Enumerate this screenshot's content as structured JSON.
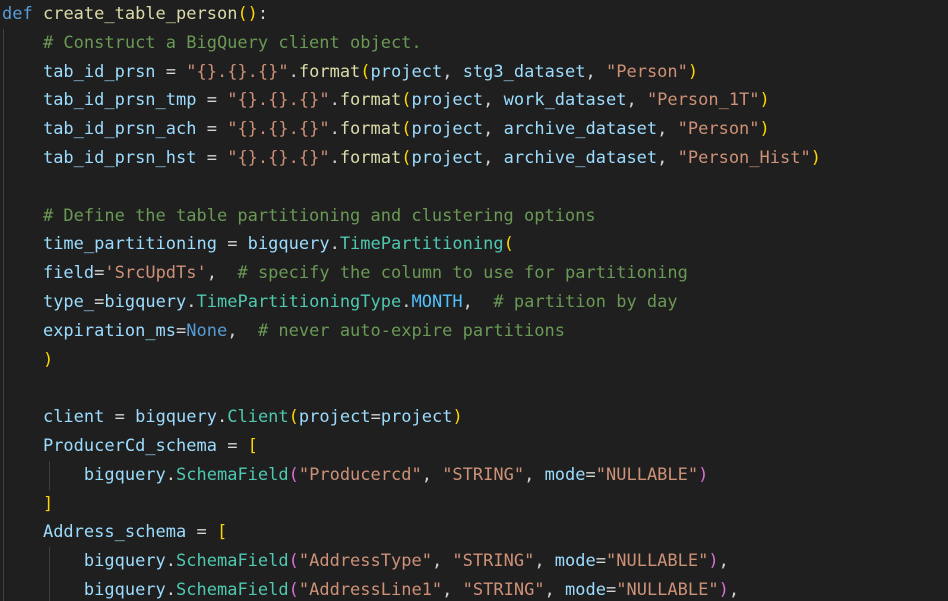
{
  "colors": {
    "background": "#1f1f1f",
    "keyword": "#569cd6",
    "function": "#dcdcaa",
    "variable": "#9cdcfe",
    "string": "#ce9178",
    "comment": "#6a9955",
    "class": "#4ec9b0",
    "constant": "#4fc1ff",
    "bracket_level1": "#ffd700",
    "bracket_level2": "#da70d6",
    "bracket_level3": "#179fff"
  },
  "code": {
    "lines": [
      {
        "indent": 0,
        "tokens": [
          {
            "t": "def",
            "c": "kw"
          },
          {
            "t": " ",
            "c": "op"
          },
          {
            "t": "create_table_person",
            "c": "fn"
          },
          {
            "t": "()",
            "c": "br1"
          },
          {
            "t": ":",
            "c": "op"
          }
        ]
      },
      {
        "indent": 1,
        "tokens": [
          {
            "t": "# Construct a BigQuery client object.",
            "c": "cmt"
          }
        ]
      },
      {
        "indent": 1,
        "tokens": [
          {
            "t": "tab_id_prsn",
            "c": "var"
          },
          {
            "t": " = ",
            "c": "op"
          },
          {
            "t": "\"{}.{}.{}\"",
            "c": "str"
          },
          {
            "t": ".",
            "c": "op"
          },
          {
            "t": "format",
            "c": "fn"
          },
          {
            "t": "(",
            "c": "br1"
          },
          {
            "t": "project",
            "c": "var"
          },
          {
            "t": ", ",
            "c": "op"
          },
          {
            "t": "stg3_dataset",
            "c": "var"
          },
          {
            "t": ", ",
            "c": "op"
          },
          {
            "t": "\"Person\"",
            "c": "str"
          },
          {
            "t": ")",
            "c": "br1"
          }
        ]
      },
      {
        "indent": 1,
        "tokens": [
          {
            "t": "tab_id_prsn_tmp",
            "c": "var"
          },
          {
            "t": " = ",
            "c": "op"
          },
          {
            "t": "\"{}.{}.{}\"",
            "c": "str"
          },
          {
            "t": ".",
            "c": "op"
          },
          {
            "t": "format",
            "c": "fn"
          },
          {
            "t": "(",
            "c": "br1"
          },
          {
            "t": "project",
            "c": "var"
          },
          {
            "t": ", ",
            "c": "op"
          },
          {
            "t": "work_dataset",
            "c": "var"
          },
          {
            "t": ", ",
            "c": "op"
          },
          {
            "t": "\"Person_1T\"",
            "c": "str"
          },
          {
            "t": ")",
            "c": "br1"
          }
        ]
      },
      {
        "indent": 1,
        "tokens": [
          {
            "t": "tab_id_prsn_ach",
            "c": "var"
          },
          {
            "t": " = ",
            "c": "op"
          },
          {
            "t": "\"{}.{}.{}\"",
            "c": "str"
          },
          {
            "t": ".",
            "c": "op"
          },
          {
            "t": "format",
            "c": "fn"
          },
          {
            "t": "(",
            "c": "br1"
          },
          {
            "t": "project",
            "c": "var"
          },
          {
            "t": ", ",
            "c": "op"
          },
          {
            "t": "archive_dataset",
            "c": "var"
          },
          {
            "t": ", ",
            "c": "op"
          },
          {
            "t": "\"Person\"",
            "c": "str"
          },
          {
            "t": ")",
            "c": "br1"
          }
        ]
      },
      {
        "indent": 1,
        "tokens": [
          {
            "t": "tab_id_prsn_hst",
            "c": "var"
          },
          {
            "t": " = ",
            "c": "op"
          },
          {
            "t": "\"{}.{}.{}\"",
            "c": "str"
          },
          {
            "t": ".",
            "c": "op"
          },
          {
            "t": "format",
            "c": "fn"
          },
          {
            "t": "(",
            "c": "br1"
          },
          {
            "t": "project",
            "c": "var"
          },
          {
            "t": ", ",
            "c": "op"
          },
          {
            "t": "archive_dataset",
            "c": "var"
          },
          {
            "t": ", ",
            "c": "op"
          },
          {
            "t": "\"Person_Hist\"",
            "c": "str"
          },
          {
            "t": ")",
            "c": "br1"
          }
        ]
      },
      {
        "indent": 1,
        "tokens": []
      },
      {
        "indent": 1,
        "tokens": [
          {
            "t": "# Define the table partitioning and clustering options",
            "c": "cmt"
          }
        ]
      },
      {
        "indent": 1,
        "tokens": [
          {
            "t": "time_partitioning",
            "c": "var"
          },
          {
            "t": " = ",
            "c": "op"
          },
          {
            "t": "bigquery",
            "c": "var"
          },
          {
            "t": ".",
            "c": "op"
          },
          {
            "t": "TimePartitioning",
            "c": "cls"
          },
          {
            "t": "(",
            "c": "br1"
          }
        ]
      },
      {
        "indent": 1,
        "tokens": [
          {
            "t": "field",
            "c": "var"
          },
          {
            "t": "=",
            "c": "op"
          },
          {
            "t": "'SrcUpdTs'",
            "c": "str"
          },
          {
            "t": ",  ",
            "c": "op"
          },
          {
            "t": "# specify the column to use for partitioning",
            "c": "cmt"
          }
        ]
      },
      {
        "indent": 1,
        "tokens": [
          {
            "t": "type_",
            "c": "var"
          },
          {
            "t": "=",
            "c": "op"
          },
          {
            "t": "bigquery",
            "c": "var"
          },
          {
            "t": ".",
            "c": "op"
          },
          {
            "t": "TimePartitioningType",
            "c": "cls"
          },
          {
            "t": ".",
            "c": "op"
          },
          {
            "t": "MONTH",
            "c": "const"
          },
          {
            "t": ",  ",
            "c": "op"
          },
          {
            "t": "# partition by day",
            "c": "cmt"
          }
        ]
      },
      {
        "indent": 1,
        "tokens": [
          {
            "t": "expiration_ms",
            "c": "var"
          },
          {
            "t": "=",
            "c": "op"
          },
          {
            "t": "None",
            "c": "kw"
          },
          {
            "t": ",  ",
            "c": "op"
          },
          {
            "t": "# never auto-expire partitions",
            "c": "cmt"
          }
        ]
      },
      {
        "indent": 1,
        "tokens": [
          {
            "t": ")",
            "c": "br1"
          }
        ]
      },
      {
        "indent": 1,
        "tokens": []
      },
      {
        "indent": 1,
        "tokens": [
          {
            "t": "client",
            "c": "var"
          },
          {
            "t": " = ",
            "c": "op"
          },
          {
            "t": "bigquery",
            "c": "var"
          },
          {
            "t": ".",
            "c": "op"
          },
          {
            "t": "Client",
            "c": "cls"
          },
          {
            "t": "(",
            "c": "br1"
          },
          {
            "t": "project",
            "c": "var"
          },
          {
            "t": "=",
            "c": "op"
          },
          {
            "t": "project",
            "c": "var"
          },
          {
            "t": ")",
            "c": "br1"
          }
        ]
      },
      {
        "indent": 1,
        "tokens": [
          {
            "t": "ProducerCd_schema",
            "c": "var"
          },
          {
            "t": " = ",
            "c": "op"
          },
          {
            "t": "[",
            "c": "br1"
          }
        ]
      },
      {
        "indent": 2,
        "tokens": [
          {
            "t": "bigquery",
            "c": "var"
          },
          {
            "t": ".",
            "c": "op"
          },
          {
            "t": "SchemaField",
            "c": "cls"
          },
          {
            "t": "(",
            "c": "br2"
          },
          {
            "t": "\"Producercd\"",
            "c": "str"
          },
          {
            "t": ", ",
            "c": "op"
          },
          {
            "t": "\"STRING\"",
            "c": "str"
          },
          {
            "t": ", ",
            "c": "op"
          },
          {
            "t": "mode",
            "c": "var"
          },
          {
            "t": "=",
            "c": "op"
          },
          {
            "t": "\"NULLABLE\"",
            "c": "str"
          },
          {
            "t": ")",
            "c": "br2"
          }
        ]
      },
      {
        "indent": 1,
        "tokens": [
          {
            "t": "]",
            "c": "br1"
          }
        ]
      },
      {
        "indent": 1,
        "tokens": [
          {
            "t": "Address_schema",
            "c": "var"
          },
          {
            "t": " = ",
            "c": "op"
          },
          {
            "t": "[",
            "c": "br1"
          }
        ]
      },
      {
        "indent": 2,
        "tokens": [
          {
            "t": "bigquery",
            "c": "var"
          },
          {
            "t": ".",
            "c": "op"
          },
          {
            "t": "SchemaField",
            "c": "cls"
          },
          {
            "t": "(",
            "c": "br2"
          },
          {
            "t": "\"AddressType\"",
            "c": "str"
          },
          {
            "t": ", ",
            "c": "op"
          },
          {
            "t": "\"STRING\"",
            "c": "str"
          },
          {
            "t": ", ",
            "c": "op"
          },
          {
            "t": "mode",
            "c": "var"
          },
          {
            "t": "=",
            "c": "op"
          },
          {
            "t": "\"NULLABLE\"",
            "c": "str"
          },
          {
            "t": ")",
            "c": "br2"
          },
          {
            "t": ",",
            "c": "op"
          }
        ]
      },
      {
        "indent": 2,
        "tokens": [
          {
            "t": "bigquery",
            "c": "var"
          },
          {
            "t": ".",
            "c": "op"
          },
          {
            "t": "SchemaField",
            "c": "cls"
          },
          {
            "t": "(",
            "c": "br2"
          },
          {
            "t": "\"AddressLine1\"",
            "c": "str"
          },
          {
            "t": ", ",
            "c": "op"
          },
          {
            "t": "\"STRING\"",
            "c": "str"
          },
          {
            "t": ", ",
            "c": "op"
          },
          {
            "t": "mode",
            "c": "var"
          },
          {
            "t": "=",
            "c": "op"
          },
          {
            "t": "\"NULLABLE\"",
            "c": "str"
          },
          {
            "t": ")",
            "c": "br2"
          },
          {
            "t": ",",
            "c": "op"
          }
        ]
      }
    ]
  }
}
